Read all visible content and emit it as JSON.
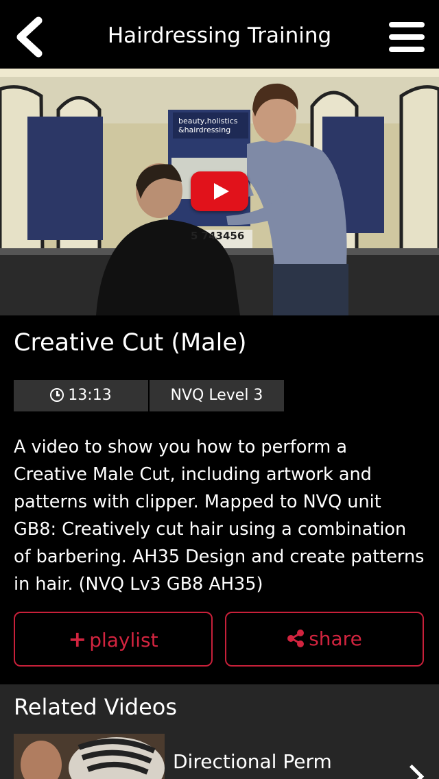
{
  "header": {
    "title": "Hairdressing Training"
  },
  "video": {
    "poster_left_text": "beauty,holistics &hairdressing",
    "poster_phone": "5 743456"
  },
  "item": {
    "title": "Creative Cut (Male)",
    "duration": "13:13",
    "level": "NVQ Level 3",
    "description": "A video to show you how to perform a Creative Male Cut, including artwork and patterns with clipper. Mapped to NVQ unit GB8: Creatively cut hair using a combination of barbering. AH35 Design and create patterns in hair. (NVQ Lv3 GB8 AH35)"
  },
  "actions": {
    "playlist_label": "playlist",
    "share_label": "share"
  },
  "related": {
    "heading": "Related Videos",
    "items": [
      {
        "title": "Directional Perm"
      }
    ]
  },
  "colors": {
    "accent": "#d2243f",
    "play_button": "#e1121b",
    "background": "#000000",
    "pill": "#333333",
    "related_bg": "#262626"
  },
  "icons": [
    "back-arrow-icon",
    "hamburger-menu-icon",
    "play-icon",
    "clock-icon",
    "plus-icon",
    "share-icon",
    "chevron-right-icon"
  ]
}
